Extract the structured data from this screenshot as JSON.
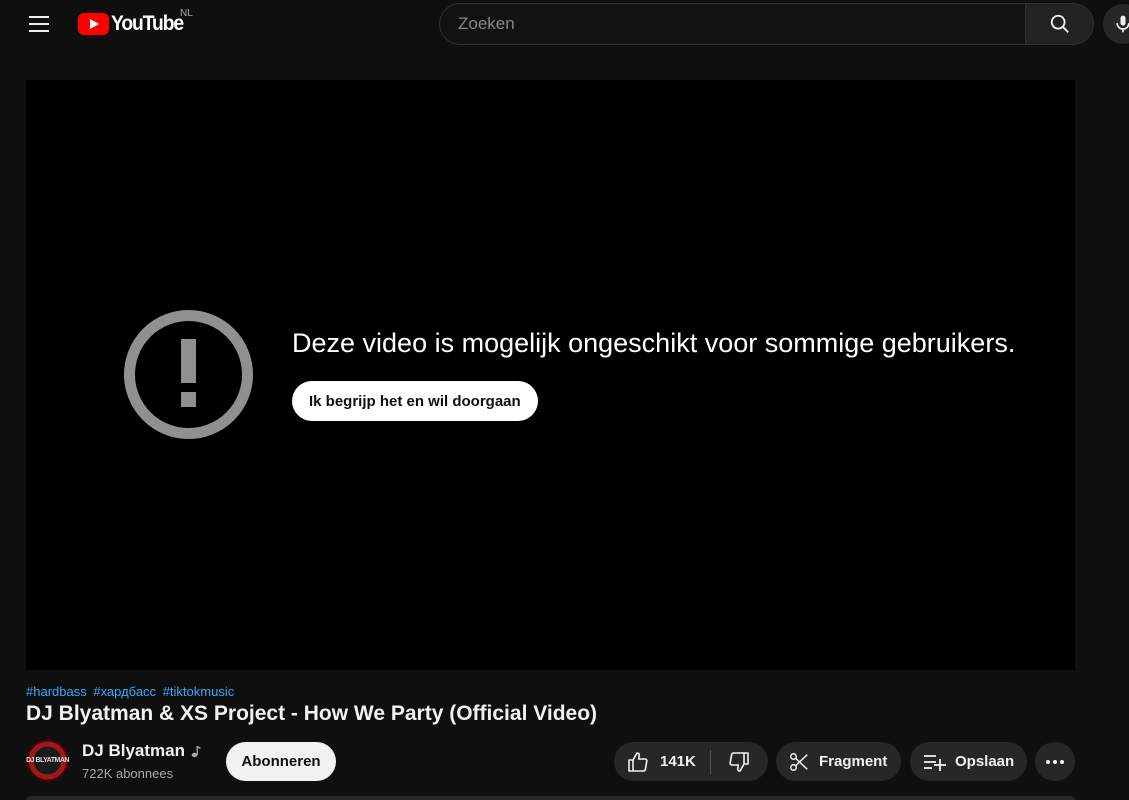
{
  "header": {
    "logo_text": "YouTube",
    "region": "NL",
    "search_placeholder": "Zoeken"
  },
  "player": {
    "warning_text": "Deze video is mogelijk ongeschikt voor sommige gebruikers.",
    "continue_label": "Ik begrijp het en wil doorgaan"
  },
  "video": {
    "hashtags": [
      "#hardbass",
      "#хардбасс",
      "#tiktokmusic"
    ],
    "title": "DJ Blyatman & XS Project - How We Party (Official Video)"
  },
  "channel": {
    "avatar_text": "DJ BLYATMAN",
    "name": "DJ Blyatman",
    "subscribers": "722K abonnees",
    "subscribe_label": "Abonneren"
  },
  "actions": {
    "likes": "141K",
    "fragment_label": "Fragment",
    "save_label": "Opslaan"
  },
  "colors": {
    "background": "#0f0f0f",
    "brand_red": "#ff0000",
    "link_blue": "#3ea6ff",
    "pill_bg": "#272727"
  },
  "icons": [
    "menu-icon",
    "youtube-logo-icon",
    "search-icon",
    "mic-icon",
    "warning-icon",
    "music-note-icon",
    "thumbs-up-icon",
    "thumbs-down-icon",
    "scissors-icon",
    "playlist-add-icon",
    "more-icon"
  ]
}
